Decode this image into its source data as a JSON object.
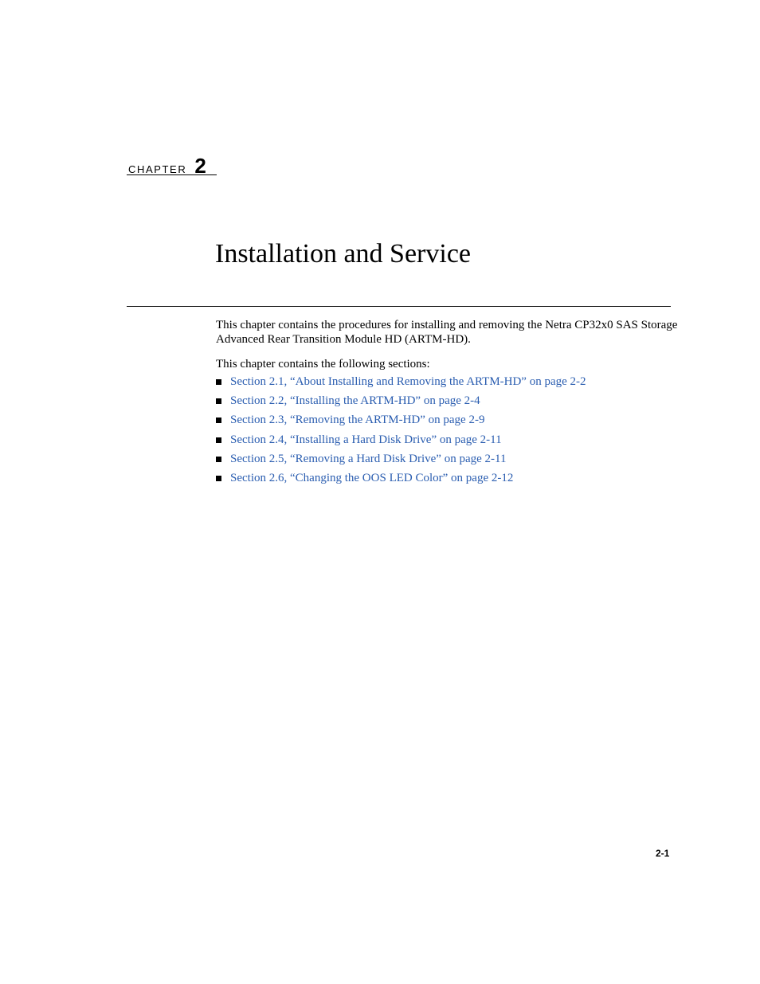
{
  "chapter": {
    "word": "CHAPTER",
    "number": "2"
  },
  "title": "Installation and Service",
  "intro": {
    "paragraph1": "This chapter contains the procedures for installing and removing the Netra CP32x0 SAS Storage Advanced Rear Transition Module HD (ARTM-HD).",
    "paragraph2": "This chapter contains the following sections:"
  },
  "sections": [
    {
      "label": "Section 2.1, “About Installing and Removing the ARTM-HD” on page 2-2"
    },
    {
      "label": "Section 2.2, “Installing the ARTM-HD” on page 2-4"
    },
    {
      "label": "Section 2.3, “Removing the ARTM-HD” on page 2-9"
    },
    {
      "label": "Section 2.4, “Installing a Hard Disk Drive” on page 2-11"
    },
    {
      "label": "Section 2.5, “Removing a Hard Disk Drive” on page 2-11"
    },
    {
      "label": "Section 2.6, “Changing the OOS LED Color” on page 2-12"
    }
  ],
  "link_color": "#2a5db0",
  "page_number": "2-1"
}
